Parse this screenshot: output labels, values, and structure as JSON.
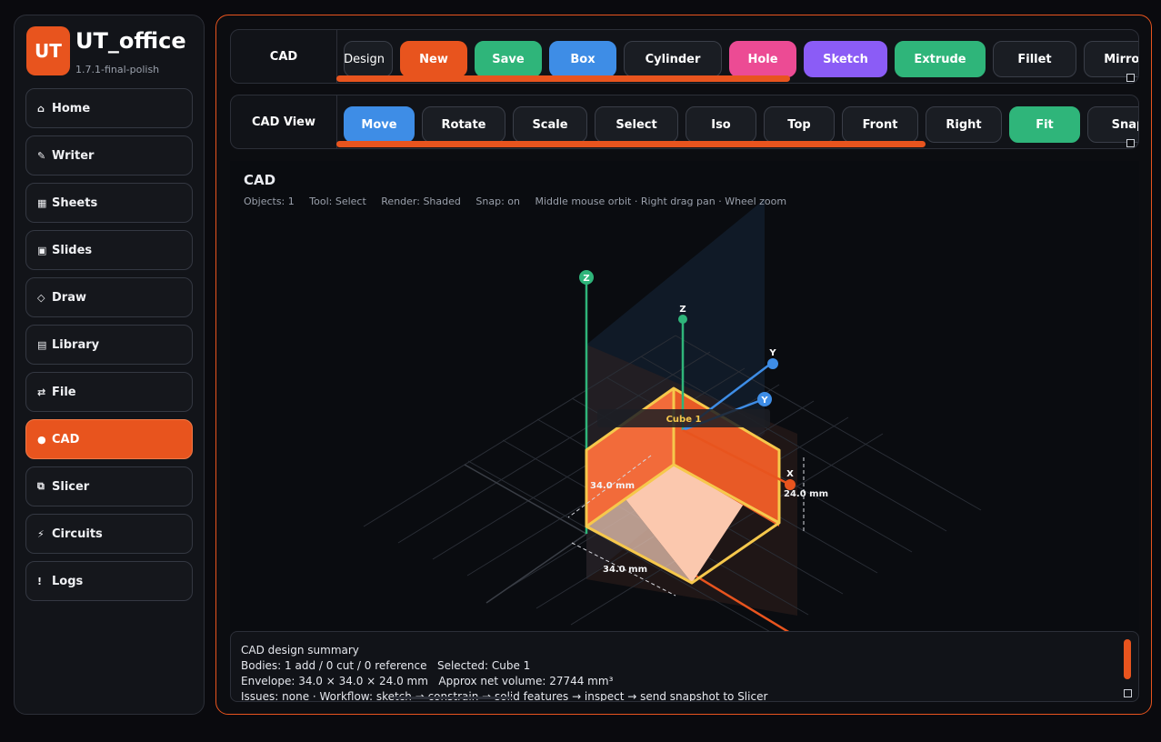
{
  "app": {
    "logo": "UT",
    "title": "UT_office",
    "version": "1.7.1-final-polish"
  },
  "nav": [
    {
      "icon": "⌂",
      "label": "Home",
      "icon_name": "home-icon"
    },
    {
      "icon": "✎",
      "label": "Writer",
      "icon_name": "pencil-icon"
    },
    {
      "icon": "▦",
      "label": "Sheets",
      "icon_name": "grid-icon"
    },
    {
      "icon": "▣",
      "label": "Slides",
      "icon_name": "slides-icon"
    },
    {
      "icon": "◇",
      "label": "Draw",
      "icon_name": "diamond-icon"
    },
    {
      "icon": "▤",
      "label": "Library",
      "icon_name": "library-icon"
    },
    {
      "icon": "⇄",
      "label": "File",
      "icon_name": "swap-icon"
    },
    {
      "icon": "●",
      "label": "CAD",
      "icon_name": "hexagon-icon",
      "active": true
    },
    {
      "icon": "⧉",
      "label": "Slicer",
      "icon_name": "layers-icon"
    },
    {
      "icon": "⚡",
      "label": "Circuits",
      "icon_name": "lightning-icon"
    },
    {
      "icon": "!",
      "label": "Logs",
      "icon_name": "alert-icon"
    }
  ],
  "toolbar_cad": {
    "label": "CAD",
    "buttons": [
      {
        "label": "Design",
        "color": ""
      },
      {
        "label": "New",
        "color": "#e8541e"
      },
      {
        "label": "Save",
        "color": "#2fb57a"
      },
      {
        "label": "Box",
        "color": "#3e8de6"
      },
      {
        "label": "Cylinder",
        "color": ""
      },
      {
        "label": "Hole",
        "color": "#ec4b94"
      },
      {
        "label": "Sketch",
        "color": "#8b5cf6"
      },
      {
        "label": "Extrude",
        "color": "#2fb57a"
      },
      {
        "label": "Fillet",
        "color": ""
      },
      {
        "label": "Mirror",
        "color": ""
      }
    ],
    "scroll_fraction": 0.57
  },
  "toolbar_view": {
    "label": "CAD View",
    "buttons": [
      {
        "label": "Move",
        "color": "#3e8de6"
      },
      {
        "label": "Rotate",
        "color": ""
      },
      {
        "label": "Scale",
        "color": ""
      },
      {
        "label": "Select",
        "color": ""
      },
      {
        "label": "Iso",
        "color": ""
      },
      {
        "label": "Top",
        "color": ""
      },
      {
        "label": "Front",
        "color": ""
      },
      {
        "label": "Right",
        "color": ""
      },
      {
        "label": "Fit",
        "color": "#2fb57a"
      },
      {
        "label": "Snap",
        "color": ""
      }
    ],
    "scroll_fraction": 0.74
  },
  "canvas": {
    "title": "CAD",
    "status": {
      "objects": "Objects: 1",
      "tool": "Tool: Select",
      "render": "Render: Shaded",
      "snap": "Snap: on",
      "hint": "Middle mouse orbit · Right drag pan · Wheel zoom"
    },
    "object_label": "Cube 1",
    "dims": {
      "width": "34.0 mm",
      "depth": "34.0 mm",
      "height": "24.0 mm"
    },
    "axes": {
      "x": "X",
      "y": "Y",
      "z": "Z"
    }
  },
  "summary": {
    "title": "CAD design summary",
    "bodies": "Bodies: 1 add / 0 cut / 0 reference",
    "selected": "Selected: Cube 1",
    "envelope": "Envelope: 34.0 × 34.0 × 24.0 mm",
    "volume": "Approx net volume: 27744 mm³",
    "issues": "Issues: none · Workflow: sketch → constrain → solid features → inspect → send snapshot to Slicer"
  },
  "colors": {
    "accent": "#e8541e",
    "green": "#2fb57a",
    "blue": "#3e8de6",
    "pink": "#ec4b94",
    "purple": "#8b5cf6",
    "cube": "#f26b3a"
  }
}
